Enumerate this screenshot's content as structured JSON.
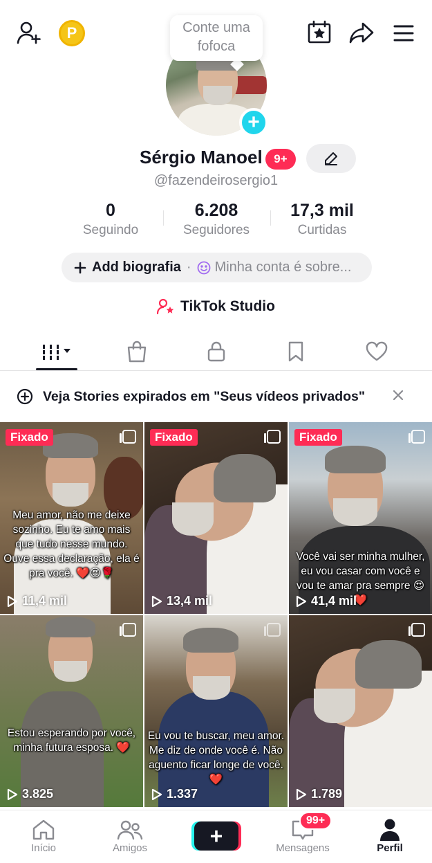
{
  "header": {
    "coin_label": "P",
    "bubble_text_line1": "Conte uma",
    "bubble_text_line2": "fofoca"
  },
  "profile": {
    "name": "Sérgio Manoel",
    "notifications_badge": "9+",
    "handle": "@fazendeirosergio1",
    "stats": [
      {
        "value": "0",
        "label": "Seguindo"
      },
      {
        "value": "6.208",
        "label": "Seguidores"
      },
      {
        "value": "17,3 mil",
        "label": "Curtidas"
      }
    ],
    "add_bio_label": "Add biografia",
    "separator": "·",
    "about_placeholder": "Minha conta é sobre...",
    "studio_label": "TikTok Studio"
  },
  "tabs": [
    "videos-grid",
    "shop",
    "private",
    "saved",
    "liked"
  ],
  "stories_banner": {
    "text": "Veja Stories expirados em \"Seus vídeos privados\""
  },
  "videos": [
    {
      "pinned_label": "Fixado",
      "views": "11,4 mil",
      "caption": "Meu amor, não me deixe sozinho. Eu te amo mais que tudo nesse mundo. Ouve essa declaração, ela é pra você. ❤️😍🌹"
    },
    {
      "pinned_label": "Fixado",
      "views": "13,4 mil",
      "caption": ""
    },
    {
      "pinned_label": "Fixado",
      "views": "41,4 mil",
      "caption": "Você vai ser minha mulher, eu vou casar com você e vou te amar pra sempre 😍❤️"
    },
    {
      "pinned_label": "",
      "views": "3.825",
      "caption": "Estou esperando por você, minha futura esposa. ❤️"
    },
    {
      "pinned_label": "",
      "views": "1.337",
      "caption": "Eu vou te buscar, meu amor. Me diz de onde você é. Não aguento ficar longe de você. ❤️"
    },
    {
      "pinned_label": "",
      "views": "1.789",
      "caption": ""
    }
  ],
  "bottom_nav": {
    "items": [
      {
        "label": "Início"
      },
      {
        "label": "Amigos"
      },
      {
        "label": "+"
      },
      {
        "label": "Mensagens"
      },
      {
        "label": "Perfil"
      }
    ],
    "messages_badge": "99+"
  },
  "colors": {
    "accent": "#fe2c55",
    "cyan": "#20d5ec",
    "text": "#161823",
    "muted": "#8a8b91"
  }
}
